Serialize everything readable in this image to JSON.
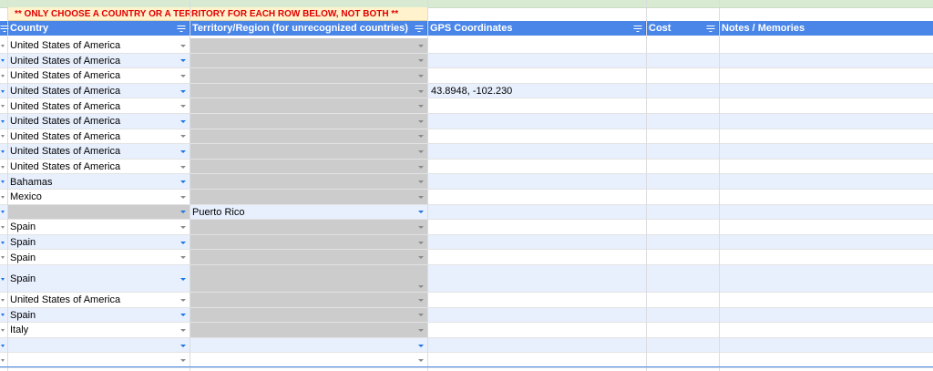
{
  "banner": "** ONLY CHOOSE A COUNTRY OR A TERRITORY FOR EACH ROW BELOW, NOT BOTH **",
  "colors": {
    "header_bg": "#4a86e8",
    "alt_row": "#e8f0fe",
    "gray_cell": "#cccccc",
    "banner_bg": "#fff2cc",
    "banner_text": "#e00000"
  },
  "icons": {
    "filter": "filter-icon",
    "dropdown": "dropdown-caret-icon"
  },
  "headers": {
    "country": "Country",
    "territory": "Territory/Region (for unrecognized countries)",
    "gps": "GPS Coordinates",
    "cost": "Cost",
    "notes": "Notes / Memories"
  },
  "rows": [
    {
      "country": "United States of America",
      "territory": "",
      "gps": "",
      "stripe": "white",
      "country_gray": false,
      "territory_gray": true
    },
    {
      "country": "United States of America",
      "territory": "",
      "gps": "",
      "stripe": "alt",
      "country_gray": false,
      "territory_gray": true
    },
    {
      "country": "United States of America",
      "territory": "",
      "gps": "",
      "stripe": "white",
      "country_gray": false,
      "territory_gray": true
    },
    {
      "country": "United States of America",
      "territory": "",
      "gps": "43.8948, -102.230",
      "stripe": "alt",
      "country_gray": false,
      "territory_gray": true
    },
    {
      "country": "United States of America",
      "territory": "",
      "gps": "",
      "stripe": "white",
      "country_gray": false,
      "territory_gray": true
    },
    {
      "country": "United States of America",
      "territory": "",
      "gps": "",
      "stripe": "alt",
      "country_gray": false,
      "territory_gray": true
    },
    {
      "country": "United States of America",
      "territory": "",
      "gps": "",
      "stripe": "white",
      "country_gray": false,
      "territory_gray": true
    },
    {
      "country": "United States of America",
      "territory": "",
      "gps": "",
      "stripe": "alt",
      "country_gray": false,
      "territory_gray": true
    },
    {
      "country": "United States of America",
      "territory": "",
      "gps": "",
      "stripe": "white",
      "country_gray": false,
      "territory_gray": true
    },
    {
      "country": "Bahamas",
      "territory": "",
      "gps": "",
      "stripe": "alt",
      "country_gray": false,
      "territory_gray": true
    },
    {
      "country": "Mexico",
      "territory": "",
      "gps": "",
      "stripe": "white",
      "country_gray": false,
      "territory_gray": true
    },
    {
      "country": "",
      "territory": "Puerto Rico",
      "gps": "",
      "stripe": "alt",
      "country_gray": true,
      "territory_gray": false
    },
    {
      "country": "Spain",
      "territory": "",
      "gps": "",
      "stripe": "white",
      "country_gray": false,
      "territory_gray": true
    },
    {
      "country": "Spain",
      "territory": "",
      "gps": "",
      "stripe": "alt",
      "country_gray": false,
      "territory_gray": true
    },
    {
      "country": "Spain",
      "territory": "",
      "gps": "",
      "stripe": "white",
      "country_gray": false,
      "territory_gray": true
    },
    {
      "country": "Spain",
      "territory": "",
      "gps": "",
      "stripe": "alt",
      "country_gray": false,
      "territory_gray": true,
      "tall": true
    },
    {
      "country": "United States of America",
      "territory": "",
      "gps": "",
      "stripe": "white",
      "country_gray": false,
      "territory_gray": true
    },
    {
      "country": "Spain",
      "territory": "",
      "gps": "",
      "stripe": "alt",
      "country_gray": false,
      "territory_gray": true
    },
    {
      "country": "Italy",
      "territory": "",
      "gps": "",
      "stripe": "white",
      "country_gray": false,
      "territory_gray": true
    },
    {
      "country": "",
      "territory": "",
      "gps": "",
      "stripe": "alt",
      "country_gray": false,
      "territory_gray": false
    },
    {
      "country": "",
      "territory": "",
      "gps": "",
      "stripe": "white",
      "country_gray": false,
      "territory_gray": false
    }
  ]
}
